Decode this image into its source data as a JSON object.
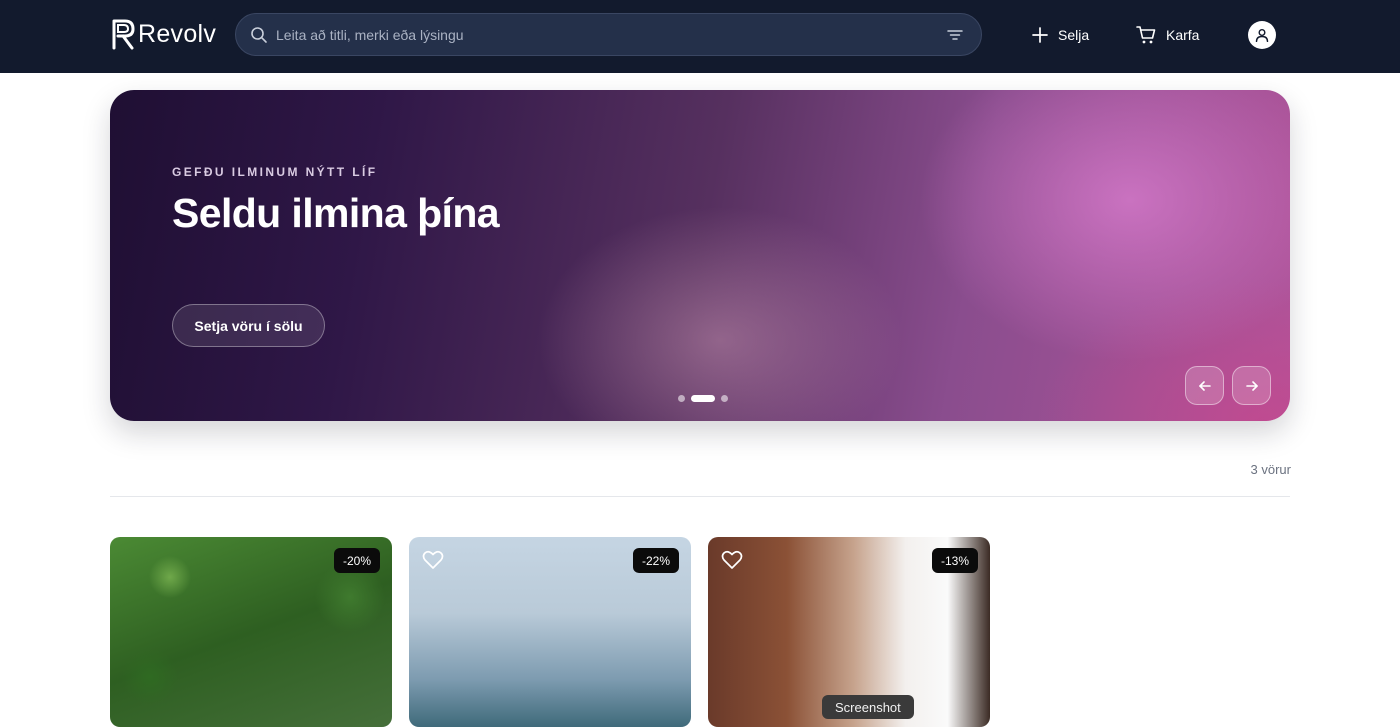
{
  "brand": {
    "name": "Revolv",
    "logo_letter": "R"
  },
  "search": {
    "placeholder": "Leita að titli, merki eða lýsingu",
    "value": ""
  },
  "nav": {
    "sell_label": "Selja",
    "cart_label": "Karfa"
  },
  "hero": {
    "eyebrow": "GEFÐU ILMINUM NÝTT LÍF",
    "title": "Seldu ilmina þína",
    "cta_label": "Setja vöru í sölu",
    "slides_count": 3,
    "active_slide": 2
  },
  "listing": {
    "count_label": "3 vörur"
  },
  "products": [
    {
      "discount": "-20%",
      "has_heart": false
    },
    {
      "discount": "-22%",
      "has_heart": true
    },
    {
      "discount": "-13%",
      "has_heart": true
    }
  ],
  "tooltip": {
    "label": "Screenshot"
  },
  "colors": {
    "header_bg": "#121a2d",
    "search_bg": "#24304a",
    "badge_bg": "#0b0b0b"
  }
}
